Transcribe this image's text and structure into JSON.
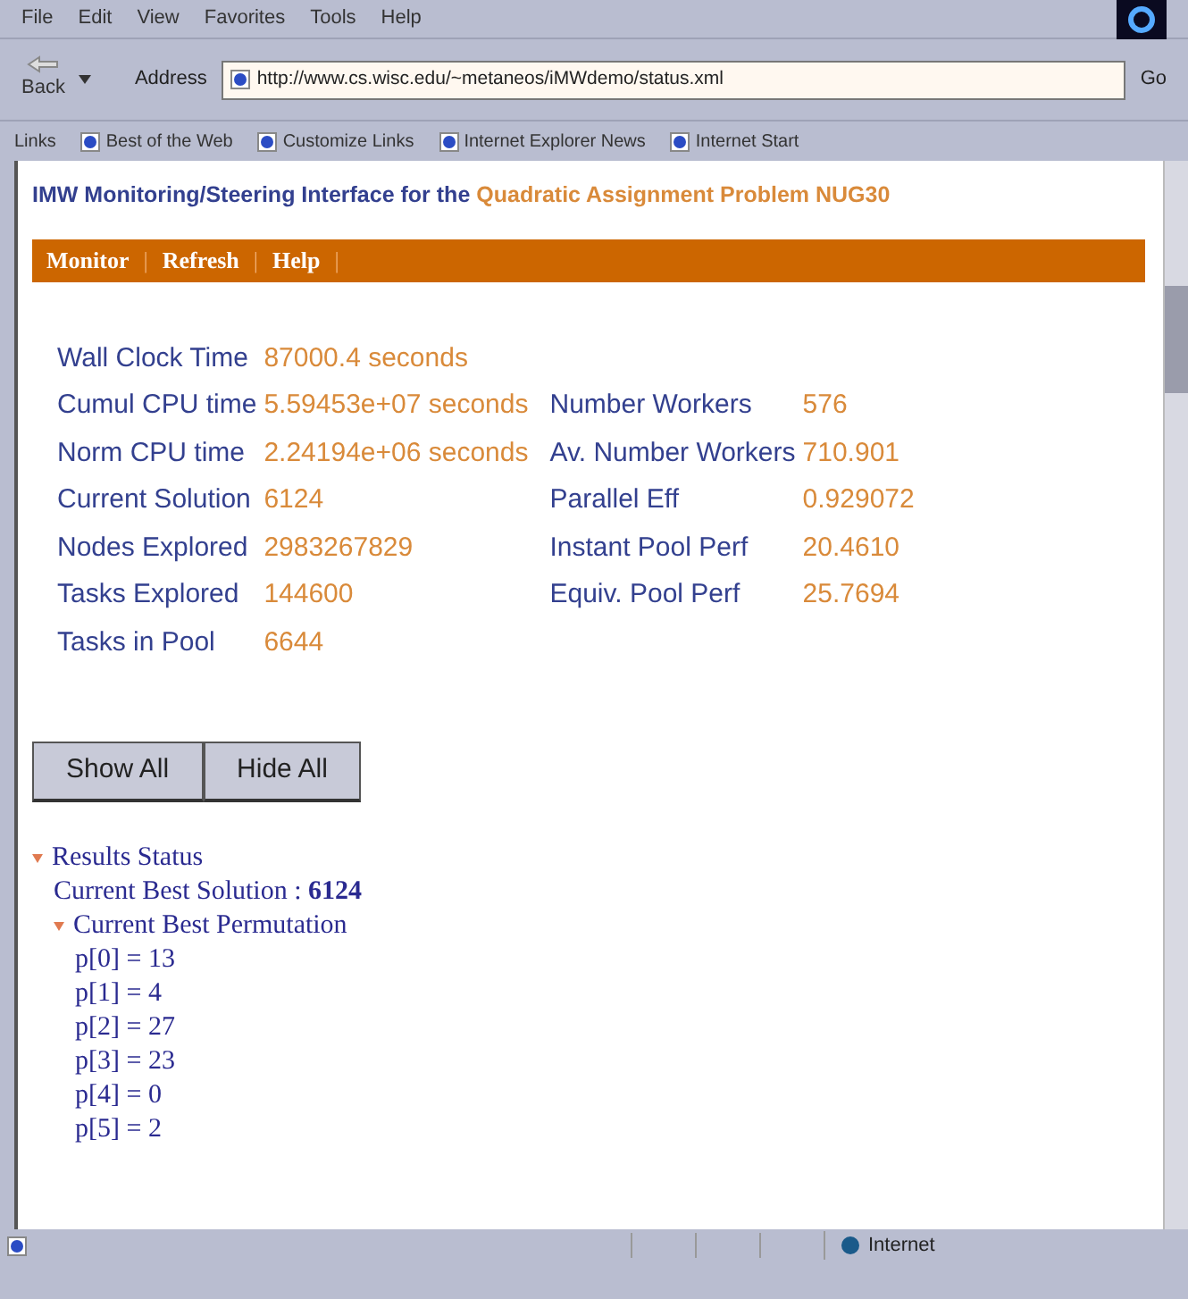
{
  "menu": [
    "File",
    "Edit",
    "View",
    "Favorites",
    "Tools",
    "Help"
  ],
  "toolbar": {
    "back": "Back",
    "address_label": "Address",
    "url": "http://www.cs.wisc.edu/~metaneos/iMWdemo/status.xml",
    "go": "Go"
  },
  "links_bar": {
    "label": "Links",
    "links": [
      "Best of the Web",
      "Customize Links",
      "Internet Explorer News",
      "Internet Start"
    ]
  },
  "page": {
    "heading": "IMW Monitoring/Steering Interface for the",
    "problem": "Quadratic Assignment Problem NUG30",
    "nav": [
      {
        "label": "Monitor",
        "separator": "|"
      },
      {
        "label": "Refresh",
        "separator": "|"
      },
      {
        "label": "Help",
        "separator": "|"
      }
    ],
    "stats": [
      {
        "left": {
          "label": "Wall Clock Time",
          "value": "87000.4 seconds"
        }
      },
      {
        "left": {
          "label": "Cumul CPU time",
          "value": "5.59453e+07 seconds"
        },
        "right": {
          "label": "Number Workers",
          "value": "576"
        }
      },
      {
        "left": {
          "label": "Norm CPU time",
          "value": "2.24194e+06 seconds"
        },
        "right": {
          "label": "Av. Number Workers",
          "value": "710.901"
        }
      },
      {
        "left": {
          "label": "Current Solution",
          "value": "6124"
        },
        "right": {
          "label": "Parallel Eff",
          "value": "0.929072"
        }
      },
      {
        "left": {
          "label": "Nodes Explored",
          "value": "2983267829"
        },
        "right": {
          "label": "Instant Pool Perf",
          "value": "20.4610"
        }
      },
      {
        "left": {
          "label": "Tasks Explored",
          "value": "144600"
        },
        "right": {
          "label": "Equiv. Pool Perf",
          "value": "25.7694"
        }
      },
      {
        "left": {
          "label": "Tasks in Pool",
          "value": "6644"
        }
      }
    ],
    "buttons": [
      "Show All",
      "Hide All"
    ],
    "tree": [
      {
        "kind": "node",
        "label": "Results Status",
        "expanded": true,
        "children": [
          {
            "kind": "text",
            "label": "Current Best Solution : ",
            "value": "6124"
          },
          {
            "kind": "node",
            "label": "Current Best Permutation",
            "expanded": true,
            "children": [
              {
                "kind": "text",
                "label": "p[0] = 13"
              },
              {
                "kind": "text",
                "label": "p[1] = 4"
              },
              {
                "kind": "text",
                "label": "p[2] = 27"
              },
              {
                "kind": "text",
                "label": "p[3] = 23"
              },
              {
                "kind": "text",
                "label": "p[4] = 0"
              },
              {
                "kind": "text",
                "label": "p[5] = 2"
              }
            ]
          }
        ]
      }
    ]
  },
  "status_bar": {
    "zone": "Internet"
  }
}
